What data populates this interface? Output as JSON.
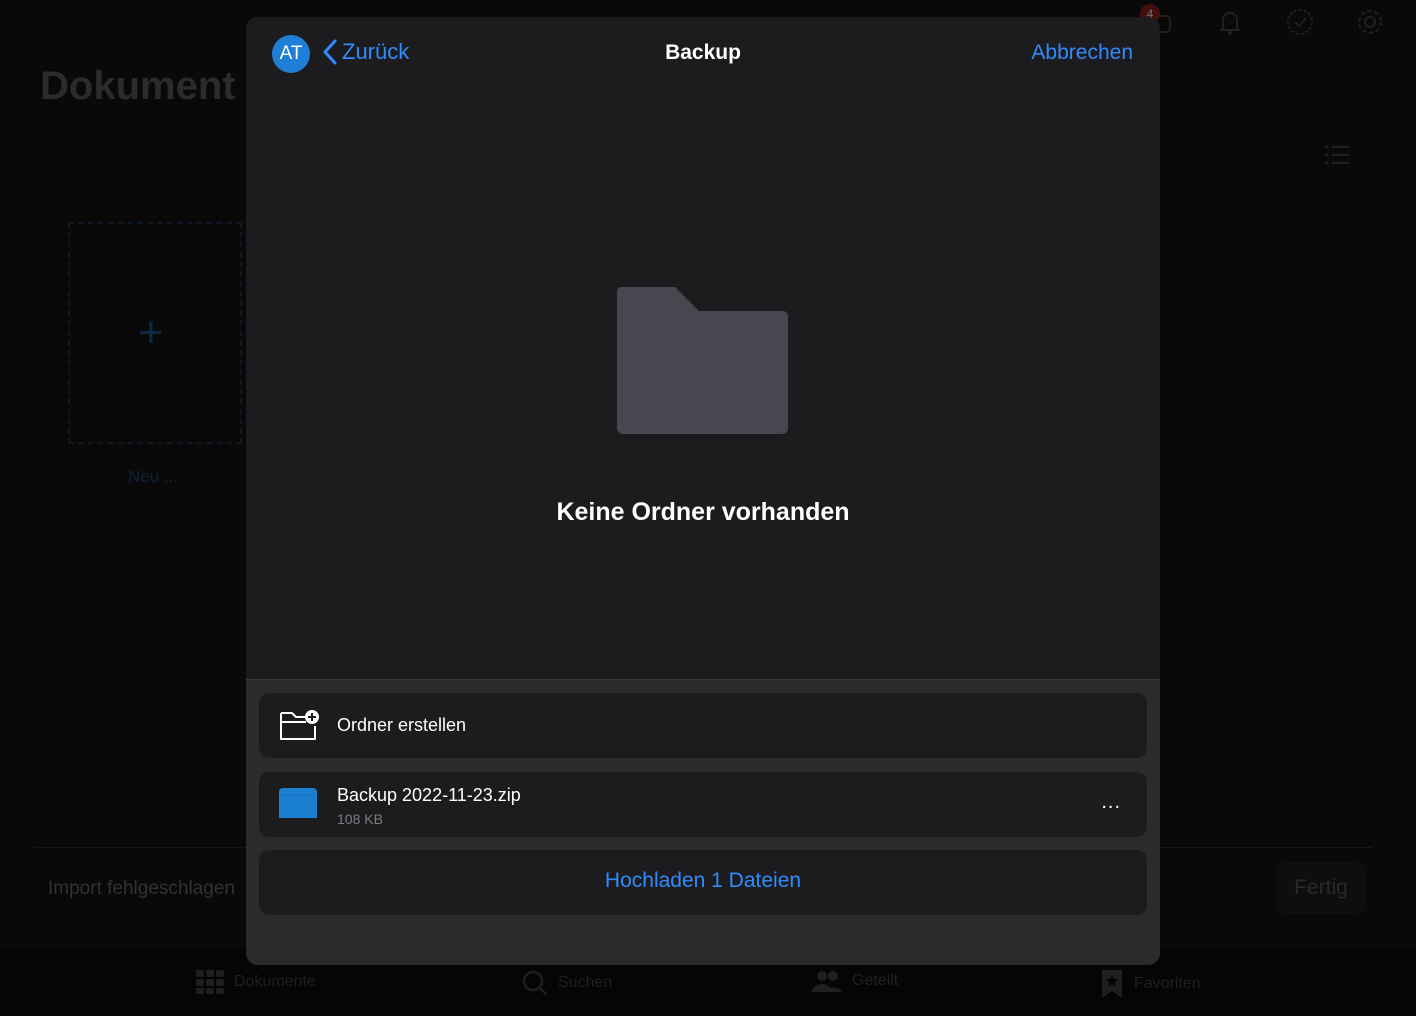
{
  "background": {
    "title": "Dokument",
    "badge_count": "4",
    "new_tile_label": "Neu ...",
    "import_status": "Import fehlgeschlagen",
    "done_button": "Fertig",
    "tabs": [
      {
        "label": "Dokumente",
        "icon": "grid-icon"
      },
      {
        "label": "Suchen",
        "icon": "search-icon"
      },
      {
        "label": "Geteilt",
        "icon": "people-icon"
      },
      {
        "label": "Favoriten",
        "icon": "bookmark-star-icon"
      }
    ]
  },
  "modal": {
    "avatar_initials": "AT",
    "back_label": "Zurück",
    "title": "Backup",
    "cancel_label": "Abbrechen",
    "empty_message": "Keine Ordner vorhanden",
    "create_folder_label": "Ordner erstellen",
    "file": {
      "name": "Backup 2022-11-23.zip",
      "size": "108 KB",
      "more": "..."
    },
    "upload_label": "Hochladen 1 Dateien"
  },
  "colors": {
    "accent": "#2f8cff",
    "modal_bg": "#1c1c1e",
    "sheet_bg": "#2b2b2d",
    "folder_placeholder": "#48464f",
    "file_icon": "#1a7fd1"
  }
}
